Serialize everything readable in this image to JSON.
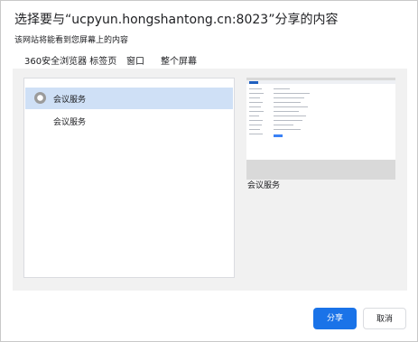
{
  "dialog": {
    "title": "选择要与“ucpyun.hongshantong.cn:8023”分享的内容",
    "subtitle": "该网站将能看到您屏幕上的内容"
  },
  "tabs": [
    {
      "label": "360安全浏览器 标签页",
      "active": true
    },
    {
      "label": "窗口",
      "active": false
    },
    {
      "label": "整个屏幕",
      "active": false
    }
  ],
  "list": {
    "items": [
      {
        "label": "会议服务",
        "selected": true,
        "icon": "browser-tab-icon"
      },
      {
        "label": "会议服务",
        "selected": false,
        "icon": null
      }
    ]
  },
  "preview": {
    "caption": "会议服务"
  },
  "buttons": {
    "share": "分享",
    "cancel": "取消"
  },
  "colors": {
    "accent": "#1a73e8",
    "selected_row": "#cfe0f6",
    "panel_bg": "#f1f1f1"
  }
}
